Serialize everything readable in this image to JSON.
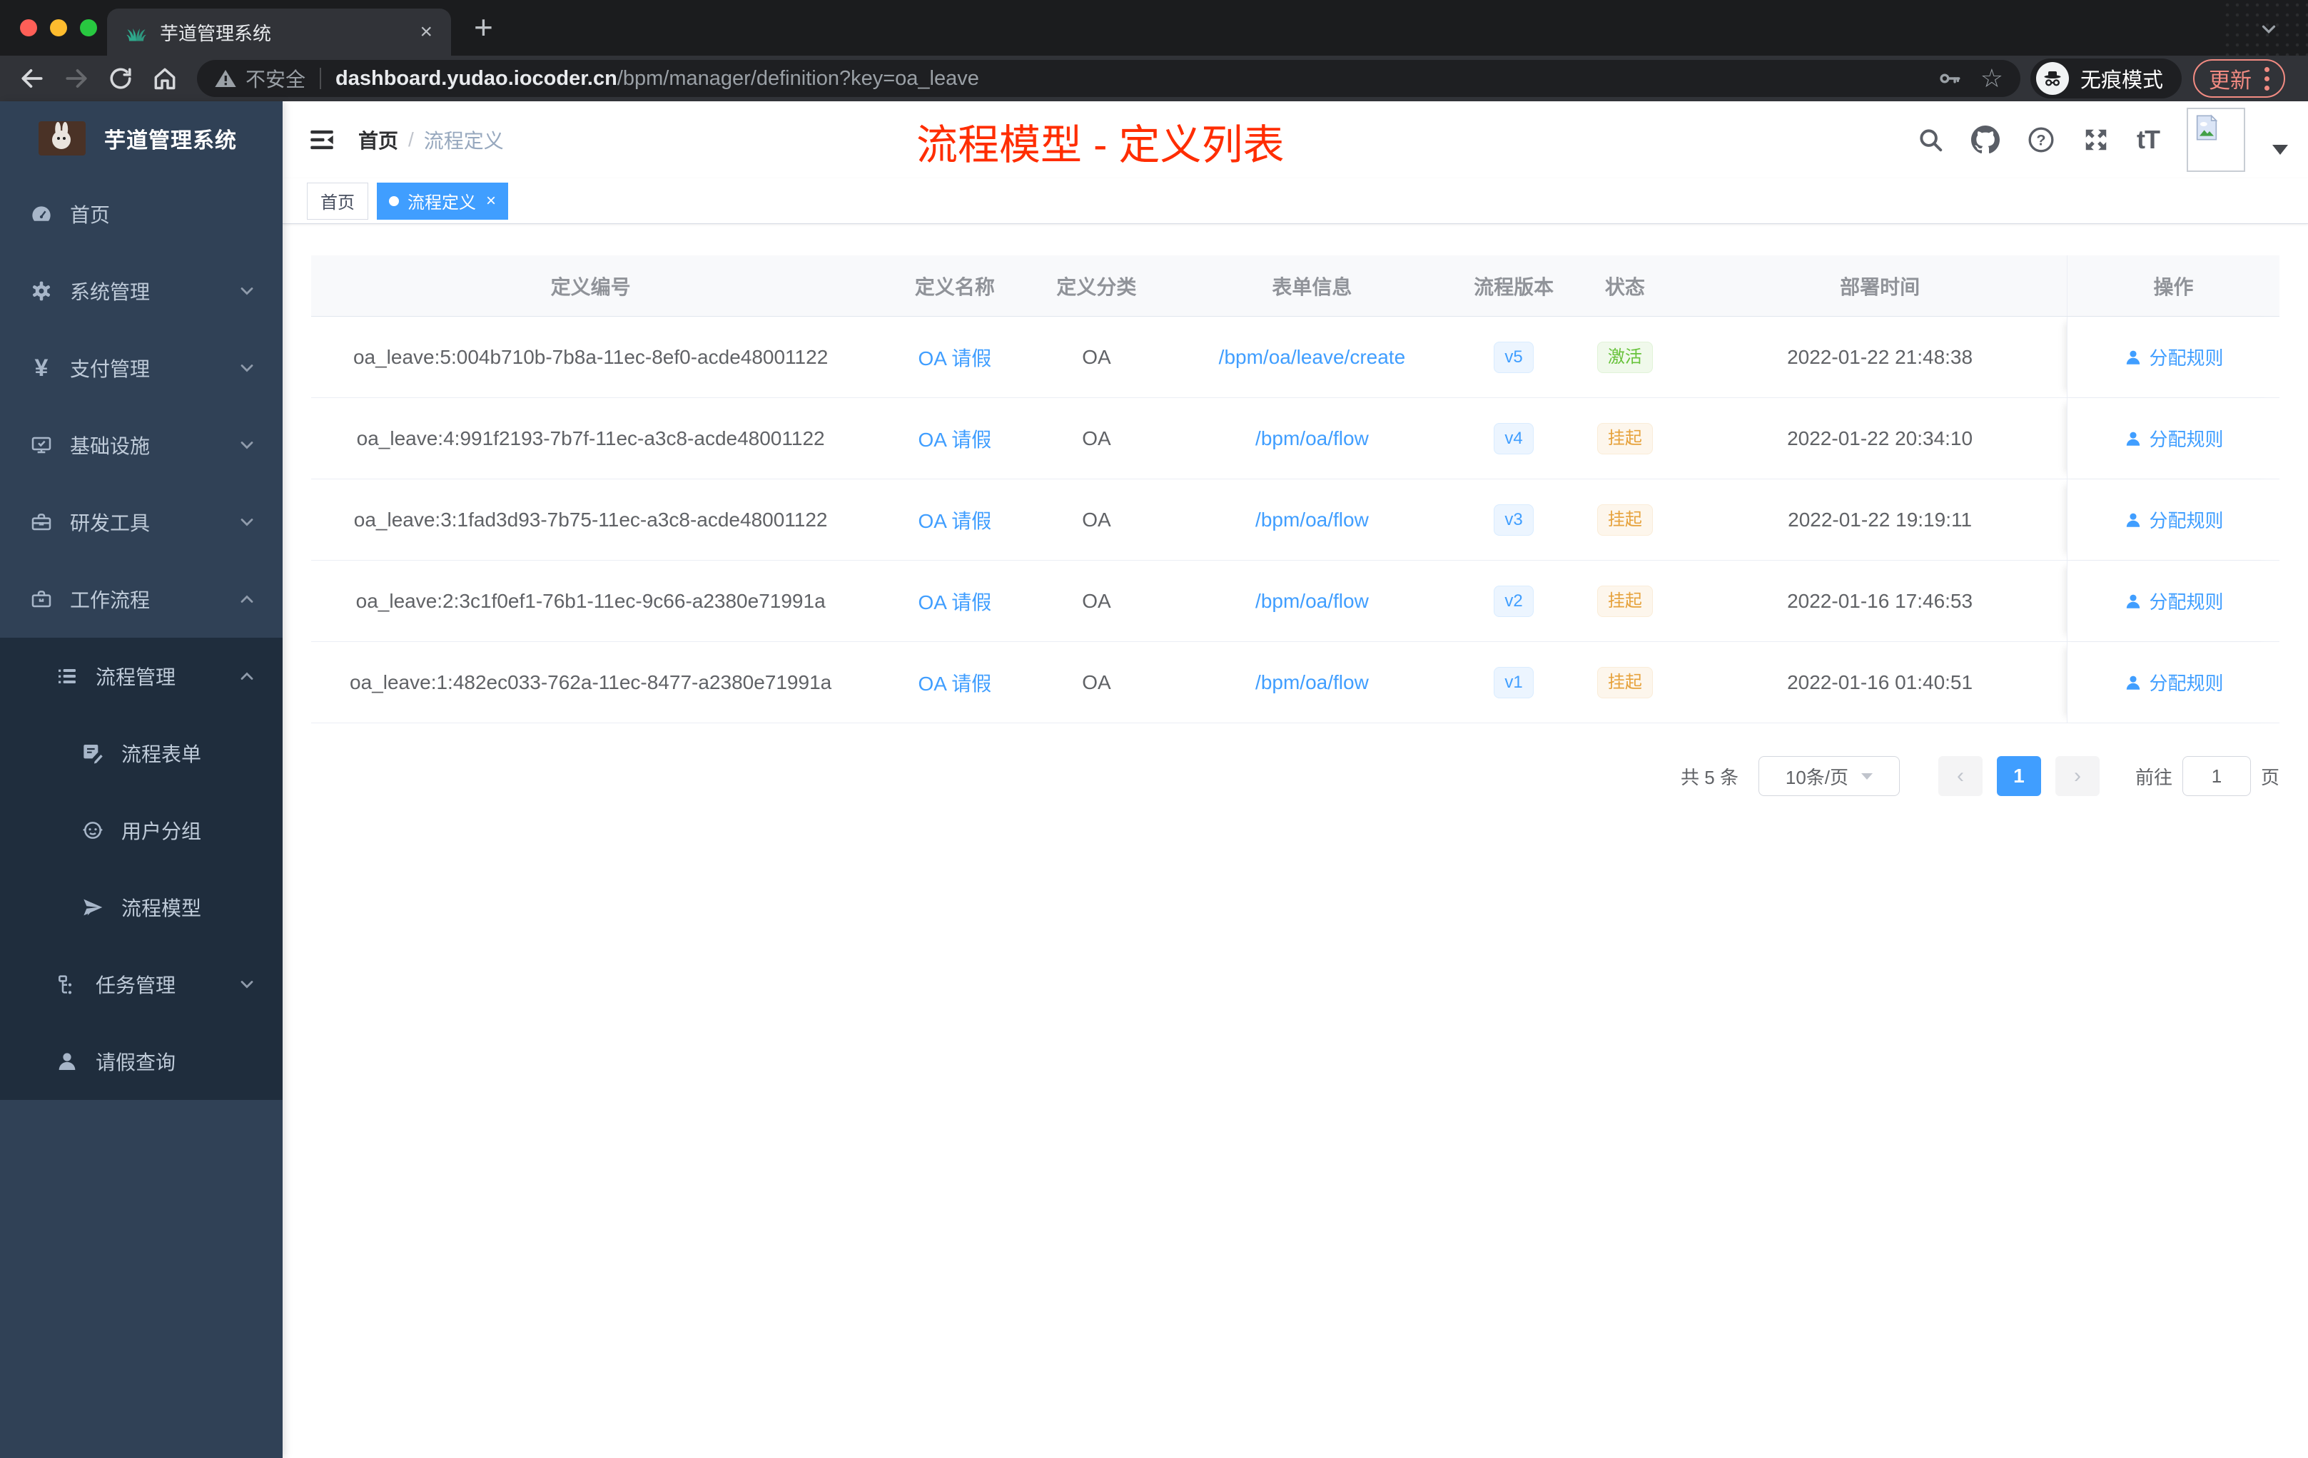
{
  "colors": {
    "accent": "#409eff",
    "title_red": "#ff2d00",
    "status_active": "#67c23a",
    "status_suspended": "#e6a23c",
    "sidebar_bg": "#304156",
    "sidebar_submenu_bg": "#1f2d3d",
    "update_badge": "#f28b82"
  },
  "browser": {
    "tab": {
      "title": "芋道管理系统",
      "close": "×"
    },
    "newtab": "+",
    "url": {
      "security_label": "不安全",
      "host": "dashboard.yudao.iocoder.cn",
      "path": "/bpm/manager/definition?key=oa_leave"
    },
    "incognito_label": "无痕模式",
    "update_label": "更新"
  },
  "sidebar": {
    "title": "芋道管理系统",
    "items": [
      {
        "label": "首页",
        "icon": "dashboard-icon",
        "level": 1
      },
      {
        "label": "系统管理",
        "icon": "gear-icon",
        "level": 1,
        "chevron": "down"
      },
      {
        "label": "支付管理",
        "icon": "yen-icon",
        "level": 1,
        "chevron": "down"
      },
      {
        "label": "基础设施",
        "icon": "monitor-icon",
        "level": 1,
        "chevron": "down"
      },
      {
        "label": "研发工具",
        "icon": "toolbox-icon",
        "level": 1,
        "chevron": "down"
      },
      {
        "label": "工作流程",
        "icon": "briefcase-icon",
        "level": 1,
        "chevron": "up"
      },
      {
        "label": "流程管理",
        "icon": "list-icon",
        "level": 2,
        "chevron": "up"
      },
      {
        "label": "流程表单",
        "icon": "form-icon",
        "level": 3
      },
      {
        "label": "用户分组",
        "icon": "robot-icon",
        "level": 3
      },
      {
        "label": "流程模型",
        "icon": "paper-plane-icon",
        "level": 3
      },
      {
        "label": "任务管理",
        "icon": "tree-icon",
        "level": 2,
        "chevron": "down"
      },
      {
        "label": "请假查询",
        "icon": "user-icon",
        "level": 2
      }
    ],
    "yen_glyph": "¥"
  },
  "header": {
    "breadcrumb": {
      "home": "首页",
      "separator": "/",
      "current": "流程定义"
    },
    "title_overlay": "流程模型 - 定义列表",
    "font_size_icon": "tT"
  },
  "tags": [
    {
      "label": "首页",
      "active": false
    },
    {
      "label": "流程定义",
      "active": true,
      "close": "×"
    }
  ],
  "table": {
    "columns": [
      "定义编号",
      "定义名称",
      "定义分类",
      "表单信息",
      "流程版本",
      "状态",
      "部署时间",
      "操作"
    ],
    "rows": [
      {
        "id": "oa_leave:5:004b710b-7b8a-11ec-8ef0-acde48001122",
        "name": "OA 请假",
        "category": "OA",
        "form": "/bpm/oa/leave/create",
        "version": "v5",
        "status": "激活",
        "status_type": "success",
        "time": "2022-01-22 21:48:38",
        "action": "分配规则"
      },
      {
        "id": "oa_leave:4:991f2193-7b7f-11ec-a3c8-acde48001122",
        "name": "OA 请假",
        "category": "OA",
        "form": "/bpm/oa/flow",
        "version": "v4",
        "status": "挂起",
        "status_type": "warning",
        "time": "2022-01-22 20:34:10",
        "action": "分配规则"
      },
      {
        "id": "oa_leave:3:1fad3d93-7b75-11ec-a3c8-acde48001122",
        "name": "OA 请假",
        "category": "OA",
        "form": "/bpm/oa/flow",
        "version": "v3",
        "status": "挂起",
        "status_type": "warning",
        "time": "2022-01-22 19:19:11",
        "action": "分配规则"
      },
      {
        "id": "oa_leave:2:3c1f0ef1-76b1-11ec-9c66-a2380e71991a",
        "name": "OA 请假",
        "category": "OA",
        "form": "/bpm/oa/flow",
        "version": "v2",
        "status": "挂起",
        "status_type": "warning",
        "time": "2022-01-16 17:46:53",
        "action": "分配规则"
      },
      {
        "id": "oa_leave:1:482ec033-762a-11ec-8477-a2380e71991a",
        "name": "OA 请假",
        "category": "OA",
        "form": "/bpm/oa/flow",
        "version": "v1",
        "status": "挂起",
        "status_type": "warning",
        "time": "2022-01-16 01:40:51",
        "action": "分配规则"
      }
    ]
  },
  "pagination": {
    "total": "共 5 条",
    "page_size": "10条/页",
    "prev": "‹",
    "current": "1",
    "next": "›",
    "goto_label": "前往",
    "goto_value": "1",
    "unit": "页"
  }
}
